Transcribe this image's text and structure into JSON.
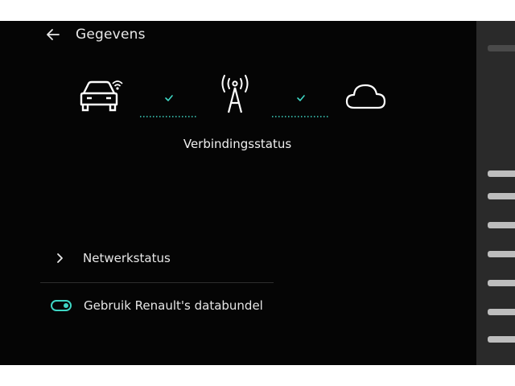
{
  "header": {
    "title": "Gegevens"
  },
  "icons": {
    "back": "arrow-left-icon",
    "car": "car-wifi-icon",
    "antenna": "antenna-icon",
    "cloud": "cloud-icon",
    "check": "check-icon"
  },
  "connection": {
    "label": "Verbindingsstatus",
    "links": [
      {
        "status": "ok"
      },
      {
        "status": "ok"
      }
    ]
  },
  "menu": {
    "network_status_label": "Netwerkstatus",
    "data_bundle_label": "Gebruik Renault's databundel",
    "data_bundle_enabled": true
  },
  "colors": {
    "accent": "#3ed6c4",
    "text": "#e8e8e8",
    "background": "#050505"
  }
}
